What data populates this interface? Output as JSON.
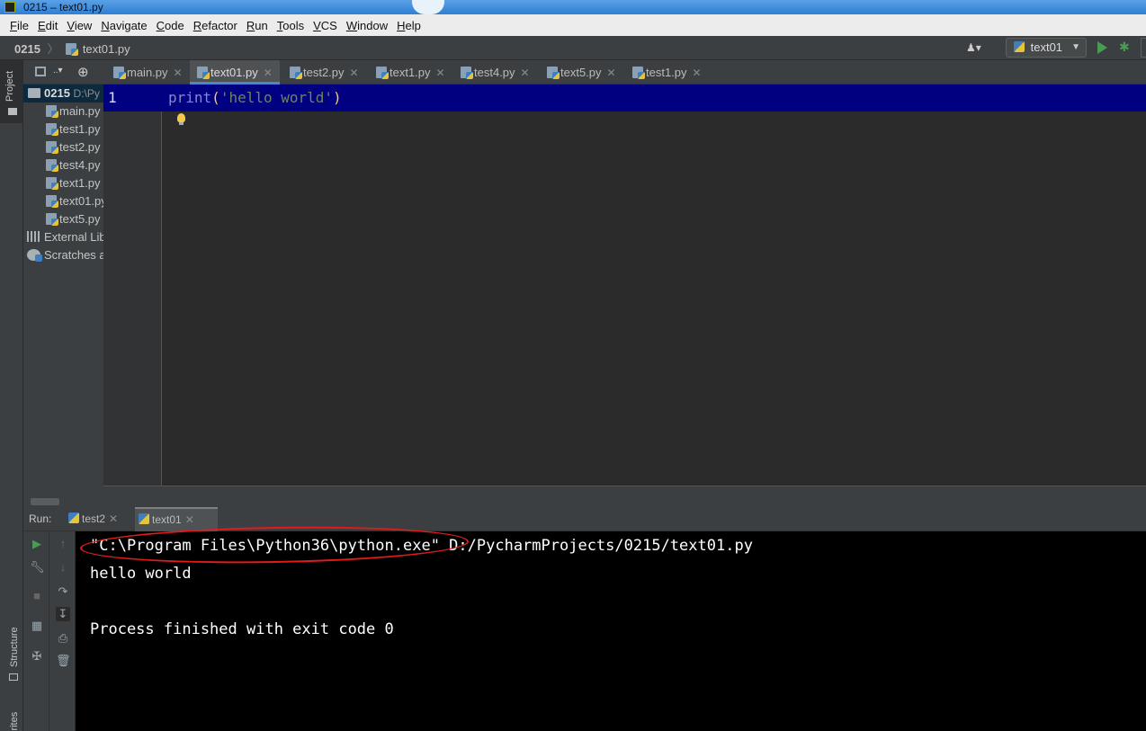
{
  "window": {
    "title": "0215 – text01.py"
  },
  "menu": [
    "File",
    "Edit",
    "View",
    "Navigate",
    "Code",
    "Refactor",
    "Run",
    "Tools",
    "VCS",
    "Window",
    "Help"
  ],
  "breadcrumb": {
    "project": "0215",
    "file": "text01.py"
  },
  "run_config": {
    "name": "text01"
  },
  "left_strip": {
    "project_tab": "Project",
    "structure_tab": "Structure",
    "favorites_tab": "Favorites"
  },
  "project_tree": {
    "root_name": "0215",
    "root_path": "D:\\Py",
    "files": [
      "main.py",
      "test1.py",
      "test2.py",
      "test4.py",
      "text1.py",
      "text01.py",
      "text5.py"
    ],
    "external_libraries": "External Lib",
    "scratches": "Scratches a"
  },
  "editor_tabs": [
    {
      "label": "main.py",
      "active": false
    },
    {
      "label": "text01.py",
      "active": true
    },
    {
      "label": "test2.py",
      "active": false
    },
    {
      "label": "text1.py",
      "active": false
    },
    {
      "label": "test4.py",
      "active": false
    },
    {
      "label": "text5.py",
      "active": false
    },
    {
      "label": "test1.py",
      "active": false
    }
  ],
  "editor": {
    "line_number": "1",
    "code": {
      "keyword": "print",
      "open": "(",
      "string": "'hello world'",
      "close": ")"
    }
  },
  "run_panel": {
    "label": "Run:",
    "tabs": [
      {
        "label": "test2",
        "active": false
      },
      {
        "label": "text01",
        "active": true
      }
    ],
    "console": {
      "interpreter": "\"C:\\Program Files\\Python36\\python.exe\"",
      "script": " D:/PycharmProjects/0215/text01.py",
      "output": "hello world",
      "exit_message": "Process finished with exit code 0"
    }
  },
  "colors": {
    "accent": "#4a88c7",
    "run_green": "#499c54",
    "line_highlight": "#000080",
    "annotation_red": "#e01b1b"
  }
}
